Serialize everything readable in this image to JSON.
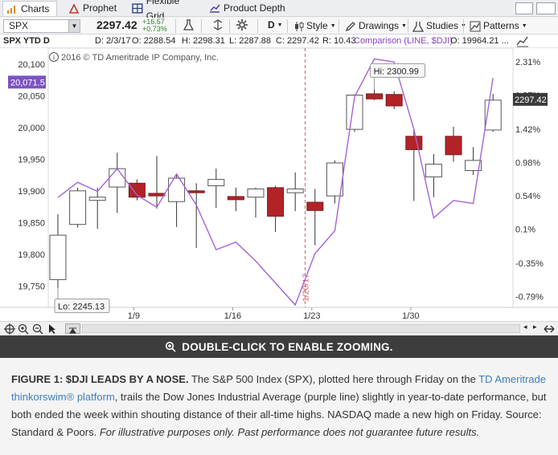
{
  "tabs": [
    {
      "label": "Charts",
      "active": true,
      "icon": "bar-chart-icon"
    },
    {
      "label": "Prophet",
      "active": false,
      "icon": "prophet-icon"
    },
    {
      "label": "Flexible Grid",
      "active": false,
      "icon": "grid-icon"
    },
    {
      "label": "Product Depth",
      "active": false,
      "icon": "product-depth-icon"
    }
  ],
  "toolbar": {
    "symbol": "SPX",
    "price": "2297.42",
    "change": "+16.57",
    "change_pct": "+0.73%",
    "aggregation": "D",
    "style_label": "Style",
    "drawings_label": "Drawings",
    "studies_label": "Studies",
    "patterns_label": "Patterns"
  },
  "infobar": {
    "title": "SPX YTD D",
    "date": "D: 2/3/17",
    "open": "O: 2288.54",
    "high": "H: 2298.31",
    "low": "L: 2287.88",
    "close": "C: 2297.42",
    "range": "R: 10.43",
    "comparison": "Comparison (LINE, $DJI)",
    "comparison_open": "O: 19964.21 ..."
  },
  "chart_data": {
    "type": "candlestick",
    "copyright": "2016 © TD Ameritrade IP Company, Inc.",
    "y_left_ticks": [
      "20,100",
      "20,050",
      "20,000",
      "19,950",
      "19,900",
      "19,850",
      "19,800",
      "19,750"
    ],
    "y_right_ticks": [
      "2.31%",
      "1.87%",
      "1.42%",
      "0.98%",
      "0.54%",
      "0.1%",
      "-0.35%",
      "-0.79%"
    ],
    "x_ticks": [
      "1/9",
      "1/16",
      "1/23",
      "1/30"
    ],
    "ylim_left": [
      19720,
      20120
    ],
    "ylim_right_pct": [
      -0.9,
      2.45
    ],
    "candles": [
      {
        "date": "1/3",
        "o": 19760,
        "h": 19863,
        "l": 19747,
        "c": 19830
      },
      {
        "date": "1/4",
        "o": 19847,
        "h": 19905,
        "l": 19842,
        "c": 19900
      },
      {
        "date": "1/5",
        "o": 19885,
        "h": 19905,
        "l": 19840,
        "c": 19890
      },
      {
        "date": "1/6",
        "o": 19906,
        "h": 19960,
        "l": 19865,
        "c": 19935
      },
      {
        "date": "1/9",
        "o": 19912,
        "h": 19918,
        "l": 19885,
        "c": 19890
      },
      {
        "date": "1/10",
        "o": 19896,
        "h": 19955,
        "l": 19872,
        "c": 19892
      },
      {
        "date": "1/11",
        "o": 19883,
        "h": 19925,
        "l": 19843,
        "c": 19920
      },
      {
        "date": "1/12",
        "o": 19900,
        "h": 19912,
        "l": 19810,
        "c": 19897
      },
      {
        "date": "1/13",
        "o": 19908,
        "h": 19935,
        "l": 19873,
        "c": 19918
      },
      {
        "date": "1/17",
        "o": 19891,
        "h": 19905,
        "l": 19868,
        "c": 19886
      },
      {
        "date": "1/18",
        "o": 19890,
        "h": 19905,
        "l": 19858,
        "c": 19903
      },
      {
        "date": "1/19",
        "o": 19905,
        "h": 19908,
        "l": 19835,
        "c": 19860
      },
      {
        "date": "1/20",
        "o": 19897,
        "h": 19929,
        "l": 19868,
        "c": 19903
      },
      {
        "date": "1/23",
        "o": 19882,
        "h": 19903,
        "l": 19814,
        "c": 19869
      },
      {
        "date": "1/24",
        "o": 19892,
        "h": 19948,
        "l": 19880,
        "c": 19944
      },
      {
        "date": "1/25",
        "o": 19997,
        "h": 20052,
        "l": 19993,
        "c": 20051
      },
      {
        "date": "1/26",
        "o": 20053,
        "h": 20060,
        "l": 20043,
        "c": 20045
      },
      {
        "date": "1/27",
        "o": 20052,
        "h": 20057,
        "l": 20029,
        "c": 20034
      },
      {
        "date": "1/30",
        "o": 19986,
        "h": 19998,
        "l": 19884,
        "c": 19965
      },
      {
        "date": "1/31",
        "o": 19922,
        "h": 19958,
        "l": 19890,
        "c": 19942
      },
      {
        "date": "2/1",
        "o": 19986,
        "h": 20001,
        "l": 19946,
        "c": 19957
      },
      {
        "date": "2/2",
        "o": 19932,
        "h": 19969,
        "l": 19925,
        "c": 19948
      },
      {
        "date": "2/3",
        "o": 19996,
        "h": 20053,
        "l": 19993,
        "c": 20043
      }
    ],
    "series": [
      {
        "symbol": "$DJI",
        "pct": [
          0.52,
          0.72,
          0.6,
          0.9,
          0.55,
          0.39,
          0.83,
          0.42,
          -0.17,
          -0.07,
          -0.32,
          -0.61,
          -0.9,
          -0.22,
          0.08,
          1.85,
          2.35,
          2.31,
          1.42,
          0.25,
          0.48,
          0.44,
          2.1
        ]
      }
    ],
    "vertical_marker": "1/20/17",
    "hi_label": "Hi: 2300.99",
    "lo_label": "Lo: 2245.13",
    "current_left_label": "20,071.5",
    "current_right_label": "2297.42",
    "colors": {
      "down_fill": "#b22327",
      "up_fill": "#ffffff",
      "candle_stroke": "#333333",
      "line": "#a463d6",
      "marker": "#e06060",
      "left_badge": "#7b53c1",
      "right_badge": "#3a3a3a"
    }
  },
  "banner": {
    "label": "DOUBLE-CLICK TO ENABLE ZOOMING."
  },
  "caption": {
    "lead": "FIGURE 1: $DJI LEADS BY A NOSE.",
    "text1": " The S&P 500 Index (SPX), plotted here through Friday on the ",
    "link": "TD Ameritrade thinkorswim® platform",
    "text2": ", trails the Dow Jones Industrial Average (purple line) slightly in year-to-date performance, but both ended the week within shouting distance of their all-time highs. NASDAQ made a new high on Friday. Source: Standard & Poors. ",
    "disclaimer": "For illustrative purposes only. Past performance does not guarantee future results."
  }
}
